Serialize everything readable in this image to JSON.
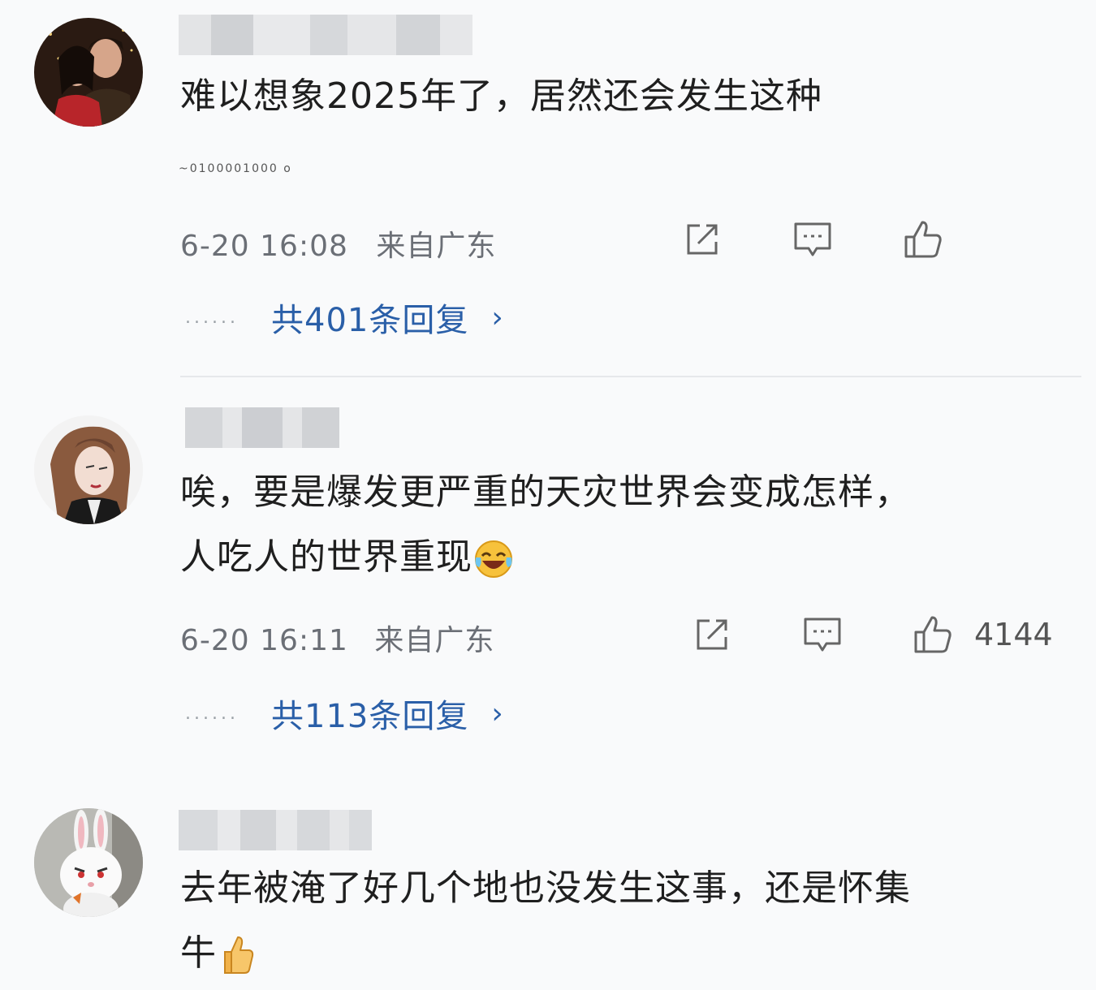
{
  "comments": [
    {
      "text": "难以想象2025年了，居然还会发生这种",
      "text_extra": "~0100001000 o",
      "time": "6-20 16:08",
      "location": "来自广东",
      "like_count": "",
      "replies": "共401条回复"
    },
    {
      "text_line1": "唉，要是爆发更严重的天灾世界会变成怎样，",
      "text_line2": "人吃人的世界重现",
      "time": "6-20 16:11",
      "location": "来自广东",
      "like_count": "4144",
      "replies": "共113条回复"
    },
    {
      "text_line1": "去年被淹了好几个地也没发生这事，还是怀集",
      "text_line2": "牛"
    }
  ],
  "icons": {
    "share": "share-icon",
    "comment": "comment-icon",
    "like": "thumbs-up-icon",
    "chevron": "chevron-right-icon",
    "laugh": "laughing-crying-emoji",
    "thumb_emoji": "thumbs-up-emoji"
  },
  "colors": {
    "link": "#2a5fa8",
    "meta": "#6b6f76",
    "background": "#f9fafb"
  }
}
